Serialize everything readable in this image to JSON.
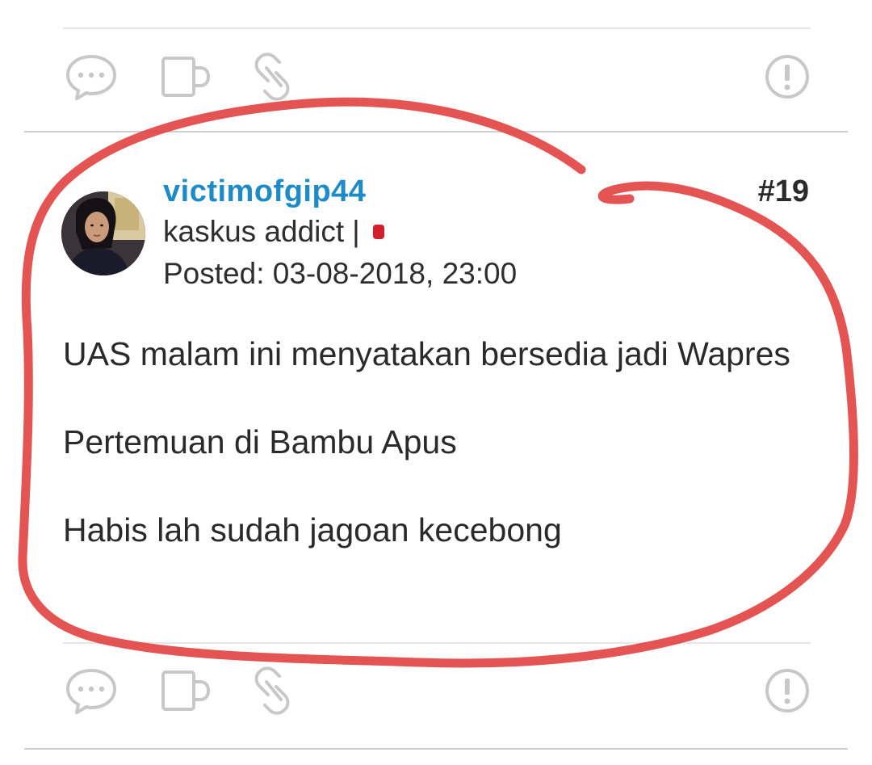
{
  "actions": {
    "quote_icon": "speech-bubble-dots",
    "mug_icon": "mug",
    "link_icon": "chain-link",
    "report_icon": "exclamation-circle"
  },
  "post": {
    "username": "victimofgip44",
    "rank": "kaskus addict",
    "rank_separator": "|",
    "status_color": "#d21f2b",
    "posted": "Posted: 03-08-2018, 23:00",
    "number": "#19",
    "body": [
      "UAS malam ini menyatakan bersedia jadi Wapres",
      "Pertemuan di Bambu Apus",
      "Habis lah sudah jagoan kecebong"
    ]
  },
  "colors": {
    "username": "#1d8bc7",
    "icon_stroke": "#c8c8c8",
    "annotation": "#e0413f"
  }
}
